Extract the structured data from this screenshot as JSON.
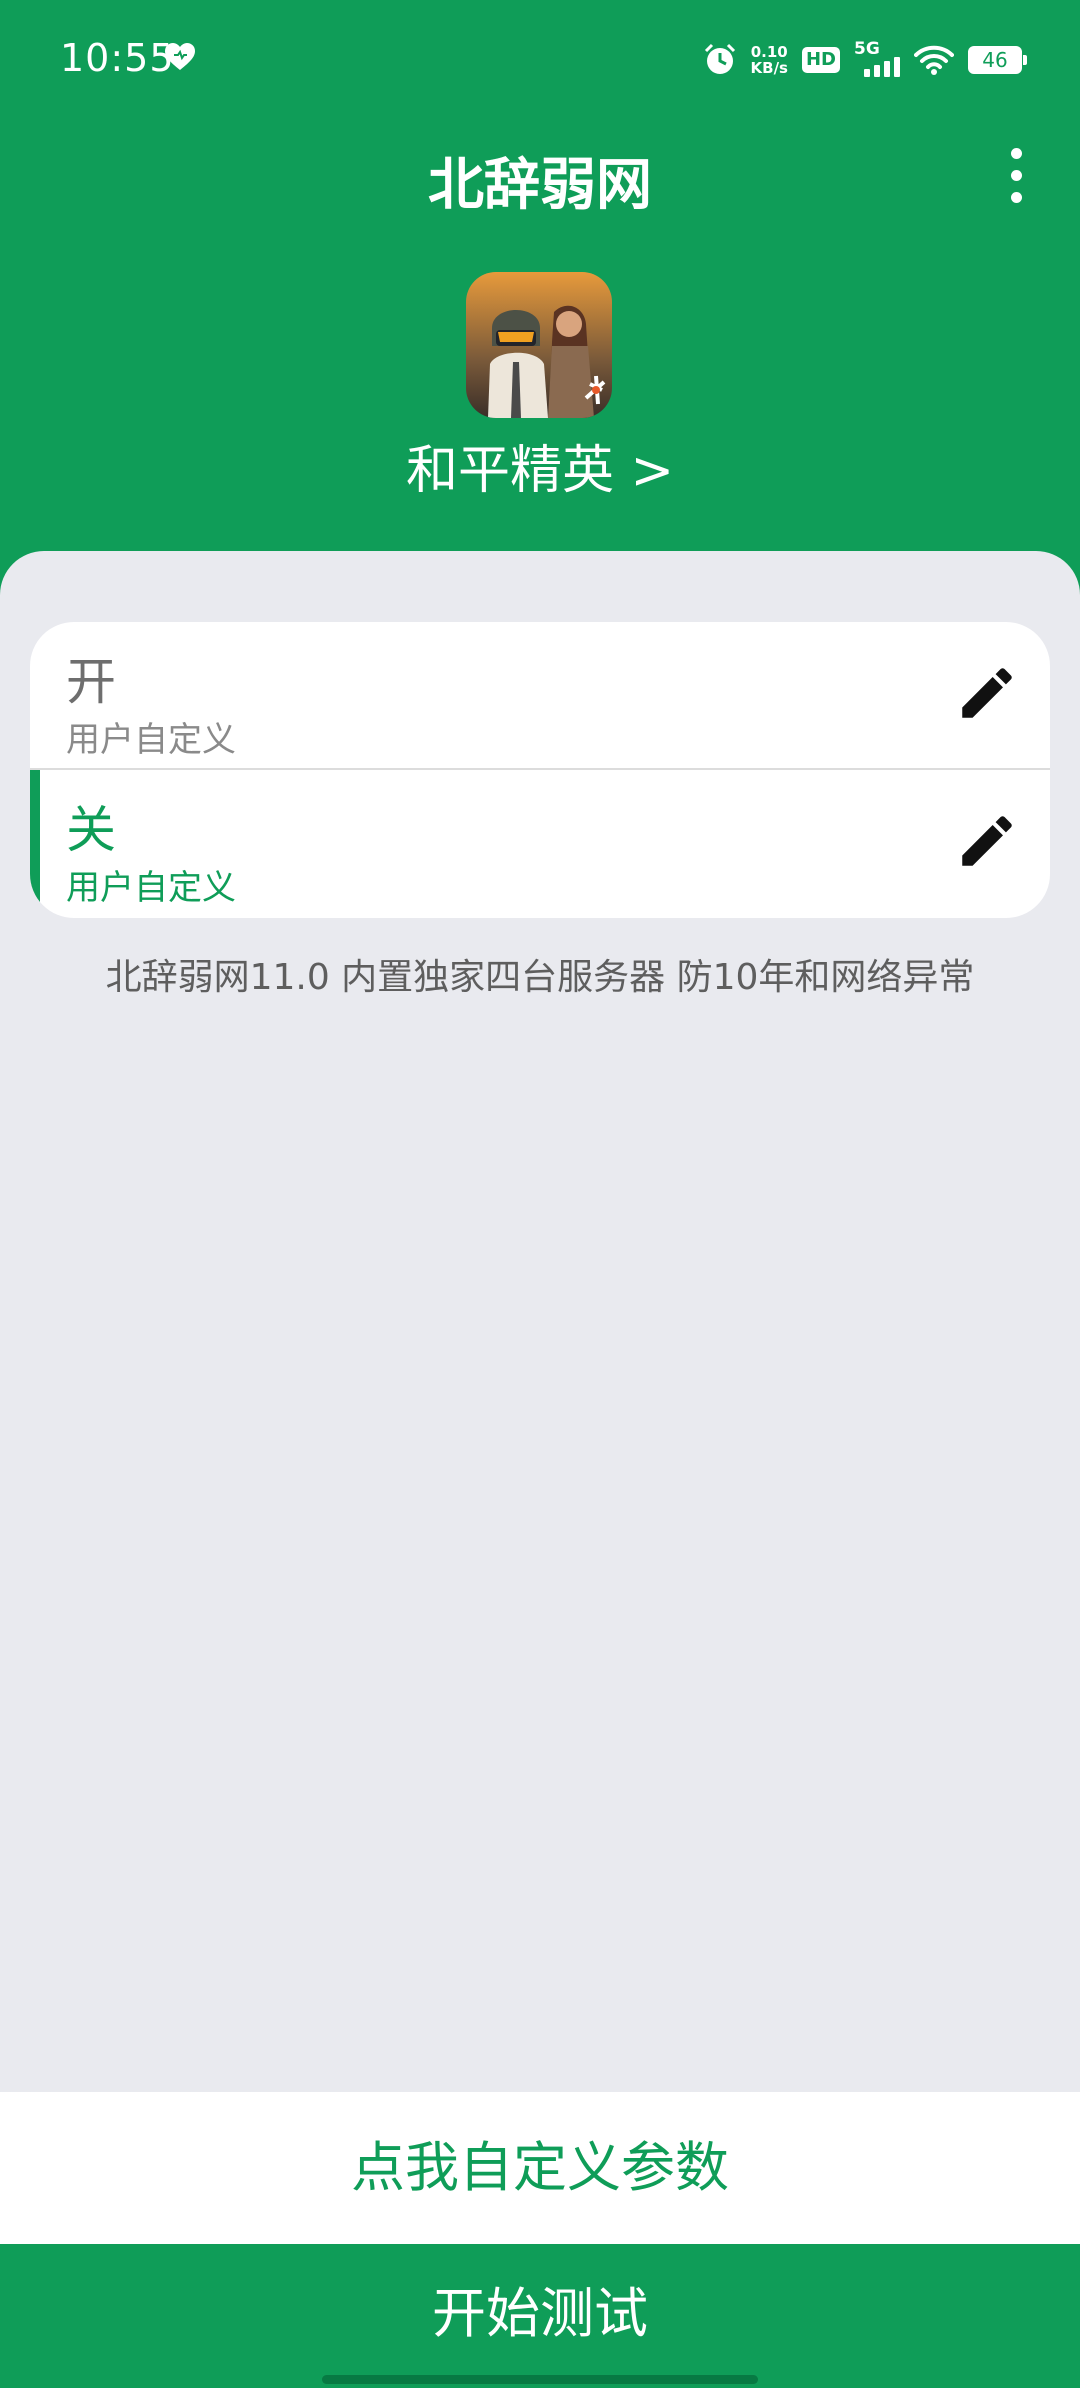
{
  "status_bar": {
    "time": "10:55",
    "net_speed_value": "0.10",
    "net_speed_unit": "KB/s",
    "hd_label": "HD",
    "network_label": "5G",
    "battery_level": "46"
  },
  "app_bar": {
    "title": "北辞弱网"
  },
  "game": {
    "name": "和平精英 >"
  },
  "modes": [
    {
      "name": "开",
      "subtitle": "用户自定义",
      "selected": false
    },
    {
      "name": "关",
      "subtitle": "用户自定义",
      "selected": true
    }
  ],
  "info_text": "北辞弱网11.0 内置独家四台服务器 防10年和网络异常",
  "buttons": {
    "custom_params": "点我自定义参数",
    "start_test": "开始测试"
  },
  "colors": {
    "primary": "#0F9D58",
    "background": "#E9EAEF",
    "card": "#FFFFFF"
  },
  "icons": {
    "status_heart": "heart-icon",
    "alarm": "alarm-icon",
    "signal": "signal-icon",
    "wifi": "wifi-icon",
    "battery": "battery-icon",
    "overflow_menu": "more-vert-icon",
    "edit": "pencil-icon"
  }
}
